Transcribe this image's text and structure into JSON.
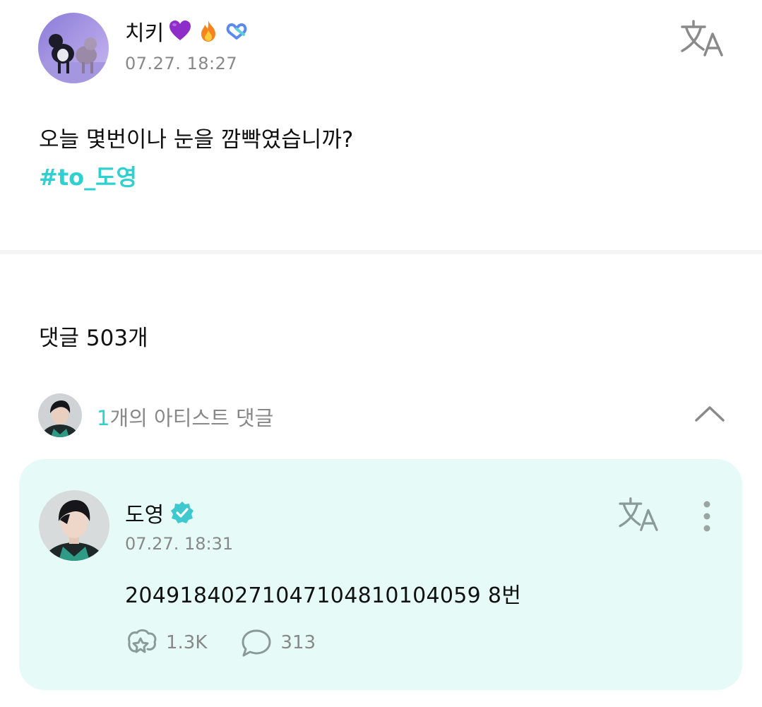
{
  "post": {
    "author": "치키",
    "time": "07.27. 18:27",
    "body": "오늘 몇번이나 눈을 깜빡였습니까?",
    "tag": "#to_도영",
    "icons": [
      "purple-heart-icon",
      "fire-icon",
      "infinity-icon",
      "translate-icon"
    ]
  },
  "comments_header": {
    "count_label": "댓글 503개"
  },
  "artist_comments": {
    "count": "1",
    "label": "개의 아티스트 댓글"
  },
  "comment": {
    "author": "도영",
    "time": "07.27. 18:31",
    "text": "20491840271047104810104059 8번",
    "likes": "1.3K",
    "replies": "313"
  },
  "colors": {
    "accent": "#2ed1cf",
    "card_bg": "#e6fbf7",
    "muted_text": "#888888",
    "verified": "#3ec9cf"
  }
}
